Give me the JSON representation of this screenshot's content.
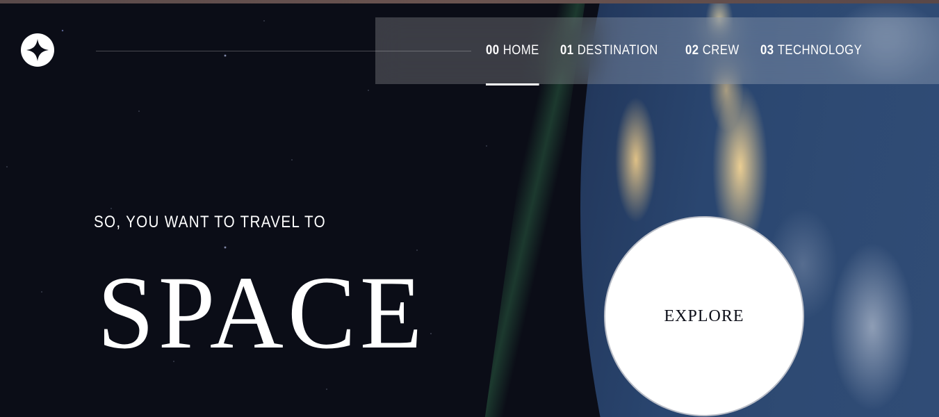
{
  "brand": {
    "logo_icon": "star-icon"
  },
  "nav": {
    "items": [
      {
        "number": "00",
        "label": "HOME",
        "active": true
      },
      {
        "number": "01",
        "label": "DESTINATION",
        "active": false
      },
      {
        "number": "02",
        "label": "CREW",
        "active": false
      },
      {
        "number": "03",
        "label": "TECHNOLOGY",
        "active": false
      }
    ]
  },
  "hero": {
    "subtitle": "SO, YOU WANT TO TRAVEL TO",
    "title": "SPACE",
    "explore_label": "EXPLORE"
  },
  "colors": {
    "background": "#0b0d17",
    "text": "#ffffff",
    "nav_bg": "rgba(255,255,255,0.2)"
  }
}
